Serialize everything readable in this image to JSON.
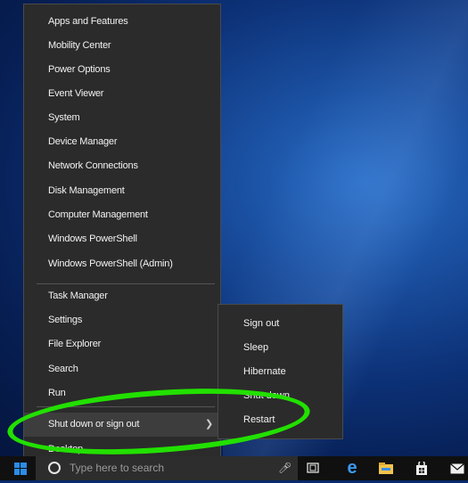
{
  "winx_menu": {
    "group1": [
      "Apps and Features",
      "Mobility Center",
      "Power Options",
      "Event Viewer",
      "System",
      "Device Manager",
      "Network Connections",
      "Disk Management",
      "Computer Management",
      "Windows PowerShell",
      "Windows PowerShell (Admin)"
    ],
    "group2": [
      "Task Manager",
      "Settings",
      "File Explorer",
      "Search",
      "Run"
    ],
    "shutdown_label": "Shut down or sign out",
    "desktop_label": "Desktop"
  },
  "submenu": {
    "items": [
      "Sign out",
      "Sleep",
      "Hibernate",
      "Shut down",
      "Restart"
    ]
  },
  "taskbar": {
    "search_placeholder": "Type here to search"
  },
  "colors": {
    "highlight": "#22e000",
    "menu_bg": "#2b2b2b"
  }
}
